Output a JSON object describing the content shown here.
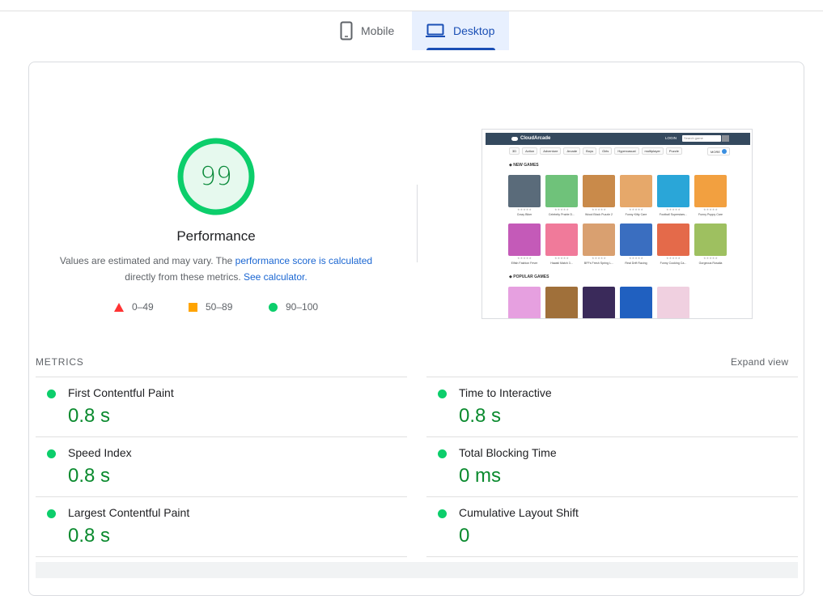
{
  "tabs": {
    "mobile": "Mobile",
    "desktop": "Desktop"
  },
  "score": {
    "value": 99,
    "title": "Performance",
    "desc_part1": "Values are estimated and may vary. The ",
    "desc_link1": "performance score is calculated",
    "desc_part2": " directly from these metrics. ",
    "desc_link2": "See calculator.",
    "color": "#0cce6b"
  },
  "legend": {
    "fail": "0–49",
    "average": "50–89",
    "pass": "90–100"
  },
  "thumbnail": {
    "brand": "CloudArcade",
    "login": "LOGIN",
    "search_placeholder": "Search game",
    "categories": [
      "3D",
      "Action",
      "Adventure",
      "Arcade",
      "Boys",
      "Girls",
      "Hypercasual",
      "multiplayer",
      "Puzzle"
    ],
    "more_label": "MORE",
    "section_new": "NEW GAMES",
    "section_popular": "POPULAR GAMES",
    "stars": "★★★★★",
    "new_games": [
      "Crazy Biker",
      "Celebrity Prairie D...",
      "Wood Block Puzzle 2",
      "Funny Kitty Care",
      "Football Superstars...",
      "Funny Puppy Care",
      "Elfish Fashion Fever",
      "Hawaii Match 3...",
      "BFFs Fresh Spring L...",
      "Real Drift Racing",
      "Funny Cooking Ca...",
      "Gorgeous Rosalia"
    ]
  },
  "metrics": {
    "label": "METRICS",
    "expand": "Expand view",
    "items": [
      {
        "name": "First Contentful Paint",
        "value": "0.8 s"
      },
      {
        "name": "Time to Interactive",
        "value": "0.8 s"
      },
      {
        "name": "Speed Index",
        "value": "0.8 s"
      },
      {
        "name": "Total Blocking Time",
        "value": "0 ms"
      },
      {
        "name": "Largest Contentful Paint",
        "value": "0.8 s"
      },
      {
        "name": "Cumulative Layout Shift",
        "value": "0"
      }
    ]
  }
}
